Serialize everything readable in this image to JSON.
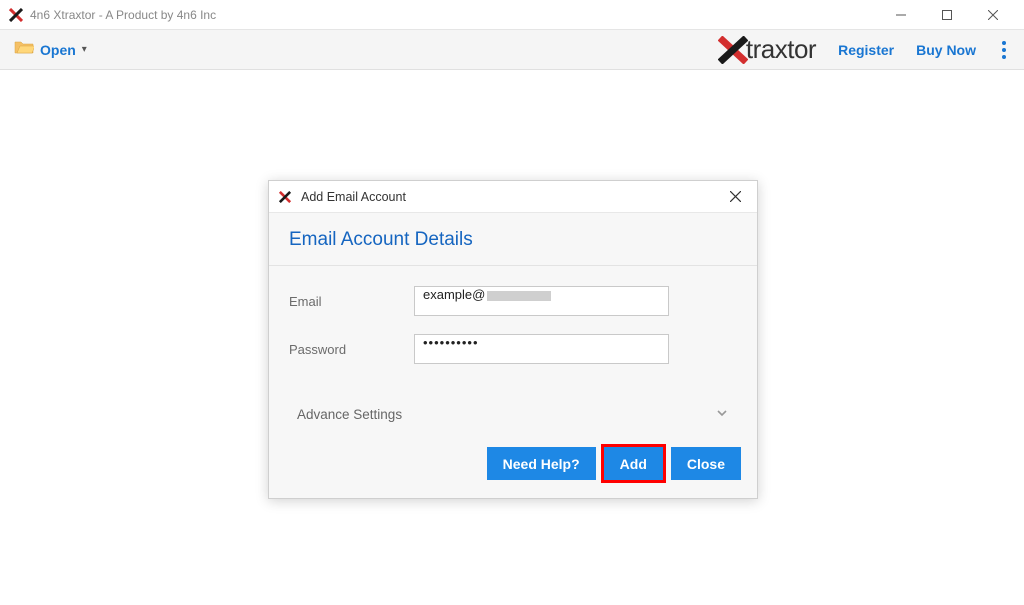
{
  "window": {
    "title": "4n6 Xtraxtor - A Product by 4n6 Inc"
  },
  "toolbar": {
    "open_label": "Open",
    "register_label": "Register",
    "buy_now_label": "Buy Now",
    "logo_text": "traxtor"
  },
  "dialog": {
    "title": "Add Email Account",
    "heading": "Email Account Details",
    "email_label": "Email",
    "email_value": "example@",
    "password_label": "Password",
    "password_value": "••••••••••",
    "advance_label": "Advance Settings",
    "buttons": {
      "help": "Need Help?",
      "add": "Add",
      "close": "Close"
    }
  }
}
